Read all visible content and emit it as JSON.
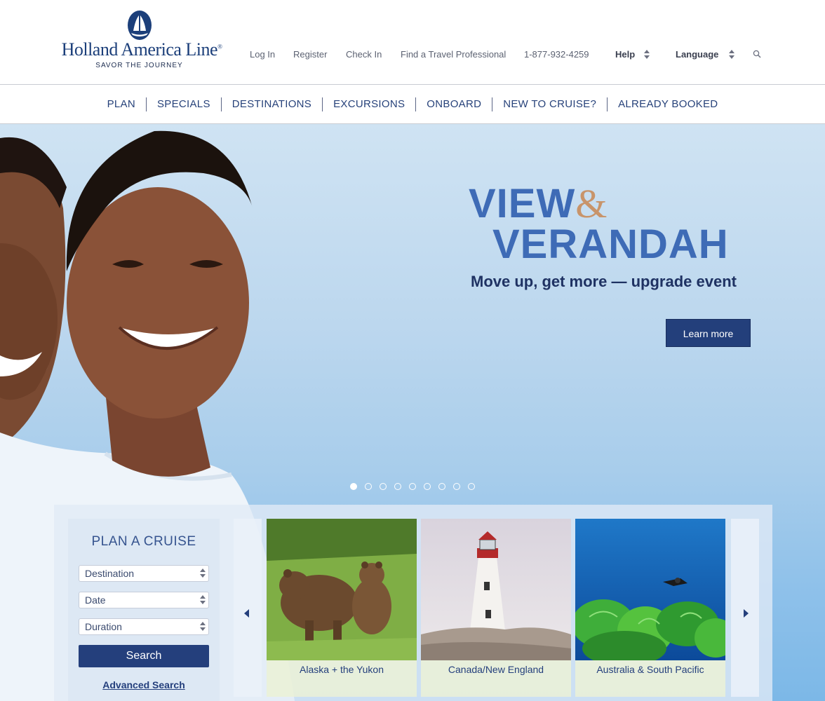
{
  "brand": {
    "name": "Holland America Line",
    "registered": "®",
    "tagline": "SAVOR THE JOURNEY"
  },
  "utility_nav": {
    "login": "Log In",
    "register": "Register",
    "checkin": "Check In",
    "find_pro": "Find a Travel Professional",
    "phone": "1-877-932-4259",
    "help": "Help",
    "language": "Language"
  },
  "main_nav": [
    "PLAN",
    "SPECIALS",
    "DESTINATIONS",
    "EXCURSIONS",
    "ONBOARD",
    "NEW TO CRUISE?",
    "ALREADY BOOKED"
  ],
  "hero": {
    "title_line1": "VIEW",
    "amp": "&",
    "title_line2": "VERANDAH",
    "subtitle": "Move up, get more — upgrade event",
    "cta": "Learn more",
    "slide_count": 9,
    "active_slide": 1
  },
  "plan_cruise": {
    "title": "PLAN A CRUISE",
    "destination": "Destination",
    "date": "Date",
    "duration": "Duration",
    "search": "Search",
    "advanced": "Advanced Search"
  },
  "destinations": [
    {
      "label": "Alaska + the Yukon"
    },
    {
      "label": "Canada/New England"
    },
    {
      "label": "Australia & South Pacific"
    }
  ],
  "colors": {
    "navy": "#243f7b",
    "hero_blue": "#3e6bb6",
    "amp_bronze": "#c8946a"
  }
}
